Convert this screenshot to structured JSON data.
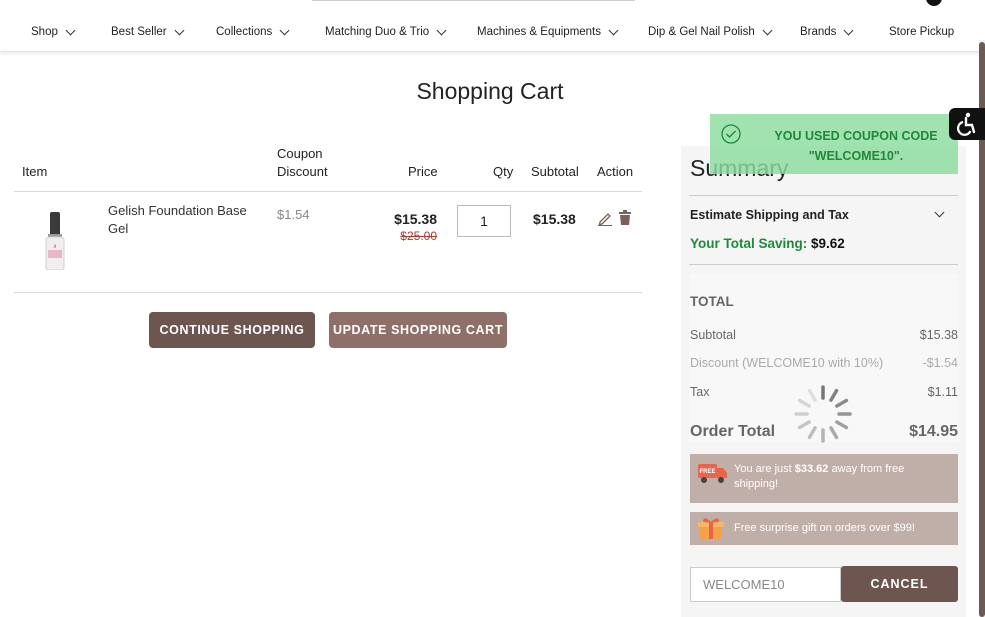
{
  "nav": {
    "items": [
      {
        "label": "Shop",
        "chevron": true
      },
      {
        "label": "Best Seller",
        "chevron": true
      },
      {
        "label": "Collections",
        "chevron": true
      },
      {
        "label": "Matching Duo & Trio",
        "chevron": true
      },
      {
        "label": "Machines & Equipments",
        "chevron": true
      },
      {
        "label": "Dip & Gel Nail Polish",
        "chevron": true
      },
      {
        "label": "Brands",
        "chevron": true
      },
      {
        "label": "Store Pickup",
        "chevron": false
      }
    ]
  },
  "page": {
    "title": "Shopping Cart"
  },
  "cart": {
    "headers": {
      "item": "Item",
      "coupon_line1": "Coupon",
      "coupon_line2": "Discount",
      "price": "Price",
      "qty": "Qty",
      "subtotal": "Subtotal",
      "action": "Action"
    },
    "rows": [
      {
        "name_line1": "Gelish Foundation Base",
        "name_line2": "Gel",
        "coupon_discount": "$1.54",
        "price": "$15.38",
        "original_price": "$25.00",
        "qty": "1",
        "subtotal": "$15.38"
      }
    ],
    "continue_label": "CONTINUE SHOPPING",
    "update_label": "UPDATE SHOPPING CART"
  },
  "summary": {
    "title": "Summary",
    "estimate_label": "Estimate Shipping and Tax",
    "saving_label": "Your Total Saving:",
    "saving_value": "$9.62",
    "total_heading": "TOTAL",
    "subtotal_label": "Subtotal",
    "subtotal_value": "$15.38",
    "discount_label": "Discount (WELCOME10 with 10%)",
    "discount_value": "-$1.54",
    "tax_label": "Tax",
    "tax_value": "$1.11",
    "order_total_label": "Order Total",
    "order_total_value": "$14.95",
    "shipping_promo_prefix": "You are just ",
    "shipping_promo_amount": "$33.62",
    "shipping_promo_suffix": " away from free",
    "shipping_promo_line2": "shipping!",
    "gift_promo": "Free surprise gift on orders over $99!",
    "coupon_value": "WELCOME10",
    "cancel_label": "CANCEL"
  },
  "toast": {
    "line1": "YOU USED COUPON CODE",
    "line2": "\"WELCOME10\"."
  },
  "colors": {
    "brand_brown": "#6e5650",
    "saving_green": "#1d8a3a",
    "toast_bg": "#8cdca0",
    "promo_bg": "#c0aea9"
  }
}
